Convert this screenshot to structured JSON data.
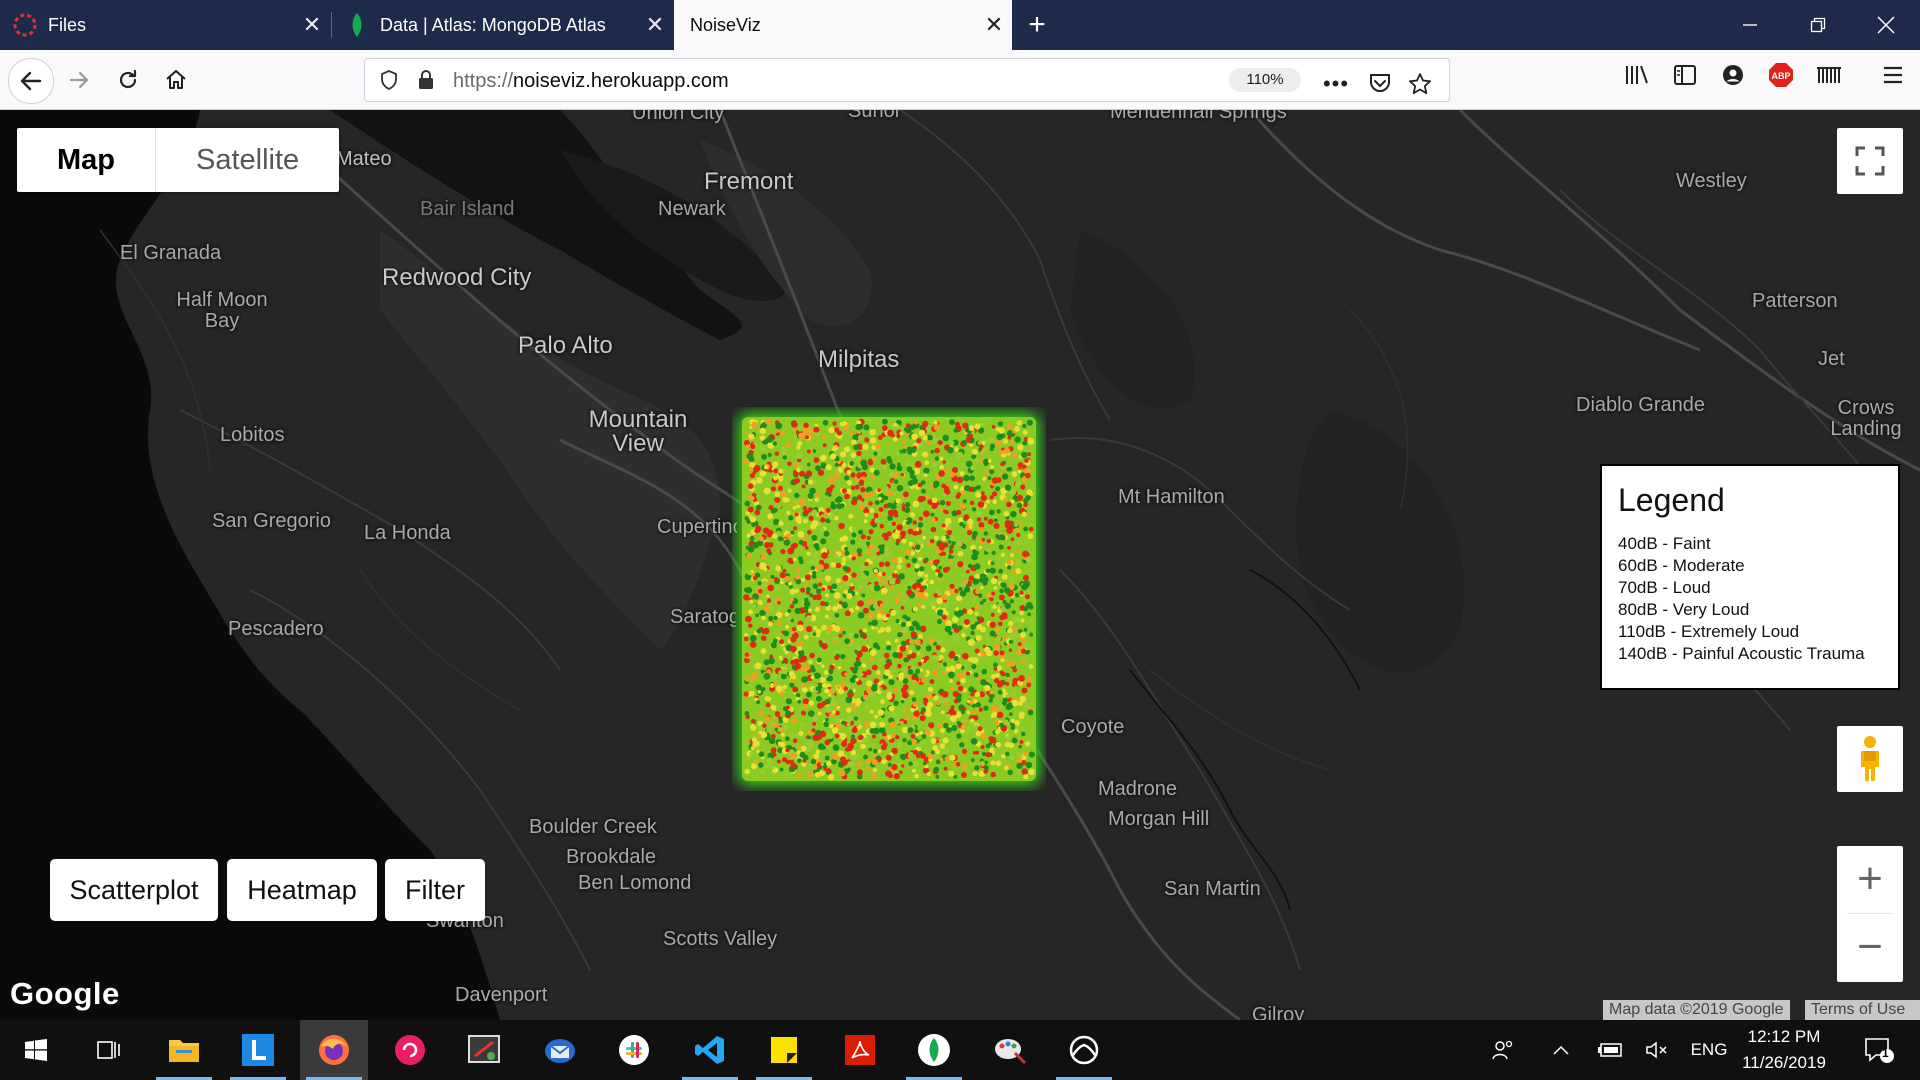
{
  "browser": {
    "tabs": [
      {
        "title": "Files",
        "active": false
      },
      {
        "title": "Data | Atlas: MongoDB Atlas",
        "active": false
      },
      {
        "title": "NoiseViz",
        "active": true
      }
    ],
    "url_protocol": "https://",
    "url_host": "noiseviz.herokuapp.com",
    "zoom": "110%"
  },
  "map": {
    "type_control": {
      "map": "Map",
      "satellite": "Satellite",
      "selected": "Map"
    },
    "places": [
      {
        "name": "Union City",
        "kind": "town"
      },
      {
        "name": "Sunol",
        "kind": "town"
      },
      {
        "name": "Mendenhall Springs",
        "kind": "town"
      },
      {
        "name": "Mateo",
        "kind": "town"
      },
      {
        "name": "Bair Island",
        "kind": "town"
      },
      {
        "name": "Fremont",
        "kind": "city"
      },
      {
        "name": "Newark",
        "kind": "town"
      },
      {
        "name": "Westley",
        "kind": "town"
      },
      {
        "name": "El Granada",
        "kind": "town"
      },
      {
        "name": "Redwood City",
        "kind": "city"
      },
      {
        "name": "Half Moon Bay",
        "kind": "town"
      },
      {
        "name": "Patterson",
        "kind": "town"
      },
      {
        "name": "Palo Alto",
        "kind": "city"
      },
      {
        "name": "Milpitas",
        "kind": "city"
      },
      {
        "name": "Jet",
        "kind": "town"
      },
      {
        "name": "Diablo Grande",
        "kind": "town"
      },
      {
        "name": "Crows Landing",
        "kind": "town"
      },
      {
        "name": "Mountain View",
        "kind": "city"
      },
      {
        "name": "Lobitos",
        "kind": "town"
      },
      {
        "name": "Mt Hamilton",
        "kind": "town"
      },
      {
        "name": "San Gregorio",
        "kind": "town"
      },
      {
        "name": "La Honda",
        "kind": "town"
      },
      {
        "name": "Cupertino",
        "kind": "town"
      },
      {
        "name": "Saratoga",
        "kind": "town"
      },
      {
        "name": "Pescadero",
        "kind": "town"
      },
      {
        "name": "Coyote",
        "kind": "town"
      },
      {
        "name": "Madrone",
        "kind": "town"
      },
      {
        "name": "Morgan Hill",
        "kind": "town"
      },
      {
        "name": "Boulder Creek",
        "kind": "town"
      },
      {
        "name": "Brookdale",
        "kind": "town"
      },
      {
        "name": "Ben Lomond",
        "kind": "town"
      },
      {
        "name": "San Martin",
        "kind": "town"
      },
      {
        "name": "Swanton",
        "kind": "town"
      },
      {
        "name": "Scotts Valley",
        "kind": "town"
      },
      {
        "name": "Davenport",
        "kind": "town"
      },
      {
        "name": "Gilroy",
        "kind": "town"
      }
    ],
    "legend": {
      "title": "Legend",
      "items": [
        "40dB - Faint",
        "60dB - Moderate",
        "70dB - Loud",
        "80dB - Very Loud",
        "110dB - Extremely Loud",
        "140dB - Painful Acoustic Trauma"
      ]
    },
    "buttons": {
      "scatterplot": "Scatterplot",
      "heatmap": "Heatmap",
      "filter": "Filter"
    },
    "zoom_in": "+",
    "zoom_out": "−",
    "logo": "Google",
    "attribution": "Map data ©2019 Google",
    "terms": "Terms of Use",
    "noise_colors": {
      "faint": "#1e8c1e",
      "moderate": "#9acd32",
      "loud": "#e8e033",
      "very_loud": "#f0a020",
      "extreme": "#e02a14"
    }
  },
  "taskbar": {
    "apps": [
      "start-icon",
      "task-view-icon",
      "file-explorer-icon",
      "launcher-l-icon",
      "firefox-icon",
      "rotate-app-icon",
      "snipping-tool-icon",
      "thunderbird-icon",
      "slack-icon",
      "vscode-icon",
      "sticky-notes-icon",
      "acrobat-icon",
      "mongodb-compass-icon",
      "paint-icon",
      "xbox-icon"
    ],
    "language": "ENG",
    "time": "12:12 PM",
    "date": "11/26/2019",
    "notifications": "1"
  }
}
